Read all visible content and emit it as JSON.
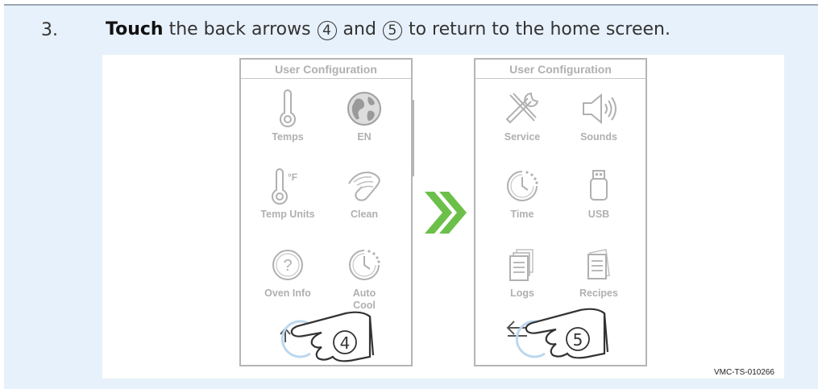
{
  "step": {
    "number": "3.",
    "bold_word": "Touch",
    "text_part1": " the back arrows ",
    "marker_a": "4",
    "text_part2": " and ",
    "marker_b": "5",
    "text_part3": " to return to the home screen."
  },
  "figure": {
    "code": "VMC-TS-010266",
    "left_screen": {
      "title": "User Configuration",
      "tiles": [
        {
          "label": "Temps",
          "icon": "thermometer-icon"
        },
        {
          "label": "EN",
          "icon": "globe-icon"
        },
        {
          "label": "Temp Units",
          "icon": "thermometer-fahrenheit-icon"
        },
        {
          "label": "Clean",
          "icon": "hand-wipe-icon"
        },
        {
          "label": "Oven Info",
          "icon": "question-icon"
        },
        {
          "label_line1": "Auto",
          "label_line2": "Cool",
          "icon": "cooldown-clock-icon"
        }
      ],
      "nav": {
        "arrow": "up-arrow-icon",
        "marker": "4"
      }
    },
    "right_screen": {
      "title": "User Configuration",
      "tiles": [
        {
          "label": "Service",
          "icon": "tools-icon"
        },
        {
          "label": "Sounds",
          "icon": "speaker-icon"
        },
        {
          "label": "Time",
          "icon": "clock-icon"
        },
        {
          "label": "USB",
          "icon": "usb-icon"
        },
        {
          "label": "Logs",
          "icon": "logs-icon"
        },
        {
          "label": "Recipes",
          "icon": "recipes-icon"
        }
      ],
      "nav": {
        "arrow": "back-arrow-icon",
        "marker": "5"
      }
    },
    "accent_color": "#6cc04a",
    "icon_color": "#b0b0b0"
  }
}
